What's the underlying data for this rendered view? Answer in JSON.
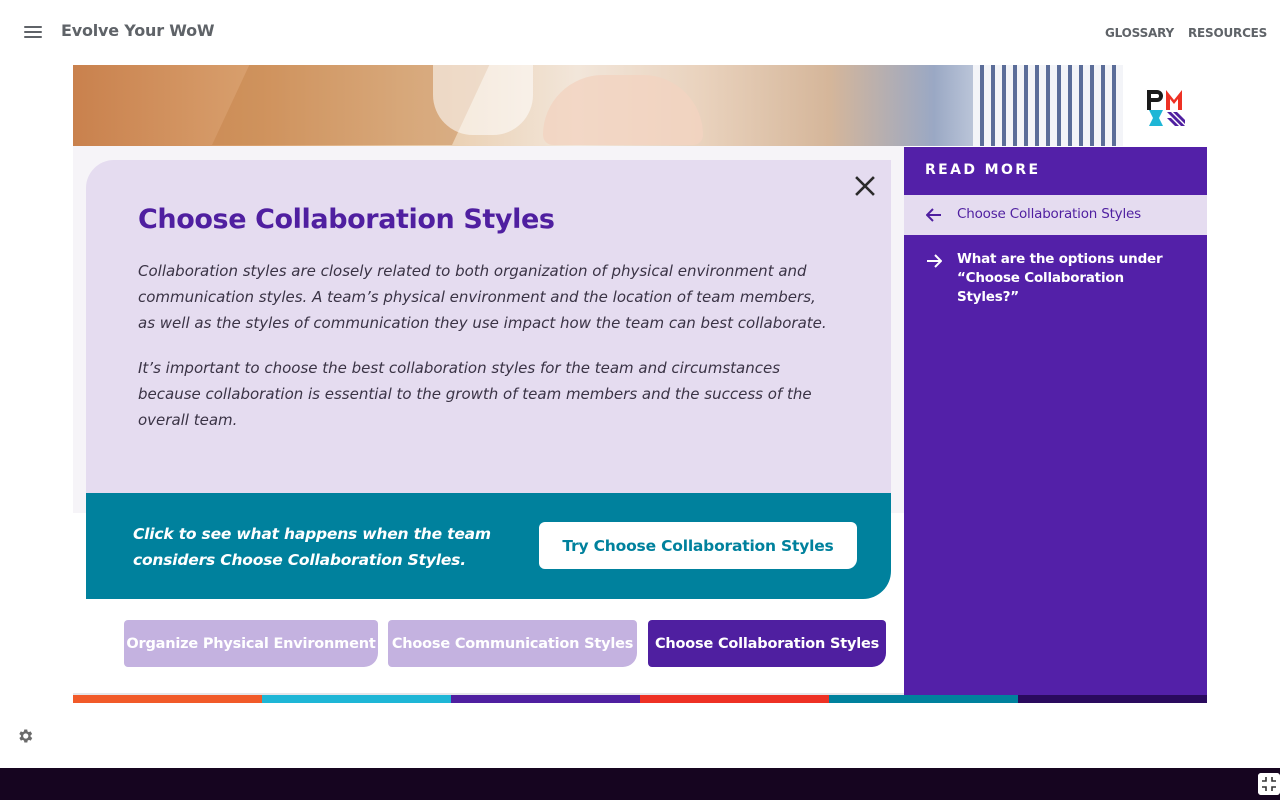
{
  "header": {
    "app_title": "Evolve Your WoW",
    "nav": [
      "GLOSSARY",
      "RESOURCES"
    ]
  },
  "icons": {
    "menu": "hamburger-icon",
    "close": "close-icon",
    "back": "arrow-left-icon",
    "forward": "arrow-right-icon",
    "settings": "gear-icon",
    "fullscreen": "exit-fullscreen-icon",
    "logo": "pmi-logo"
  },
  "main": {
    "title": "Choose Collaboration Styles",
    "paragraphs": [
      "Collaboration styles are closely related to both organization of physical environment and communication styles. A team’s physical environment and the location of team members, as well as the styles of communication they use impact how the team can best collaborate.",
      "It’s important to choose the best collaboration styles for the team and circumstances because collaboration is essential to the growth of team members and the success of the overall team."
    ],
    "cta_text": "Click to see what happens when the team considers Choose Collaboration Styles.",
    "cta_button": "Try Choose Collaboration Styles"
  },
  "tabs": [
    {
      "label": "Organize Physical Environment",
      "active": false
    },
    {
      "label": "Choose Communication Styles",
      "active": false
    },
    {
      "label": "Choose Collaboration Styles",
      "active": true
    }
  ],
  "read_more": {
    "heading": "READ MORE",
    "items": [
      {
        "label": "Choose Collaboration Styles",
        "active": true
      },
      {
        "label": "What are the options under “Choose Collaboration Styles?”",
        "active": false
      }
    ]
  },
  "colors": {
    "brand_purple": "#4f1fa0",
    "sidebar_purple": "#5320a8",
    "teal": "#00819d",
    "lavender": "#e5dcf0",
    "tab_inactive": "#c4b2e0",
    "footer": "#160520",
    "color_bar": [
      "#f15a29",
      "#1eb6d6",
      "#4f1fa0",
      "#ee3124",
      "#00819d",
      "#2a0a5e"
    ]
  }
}
